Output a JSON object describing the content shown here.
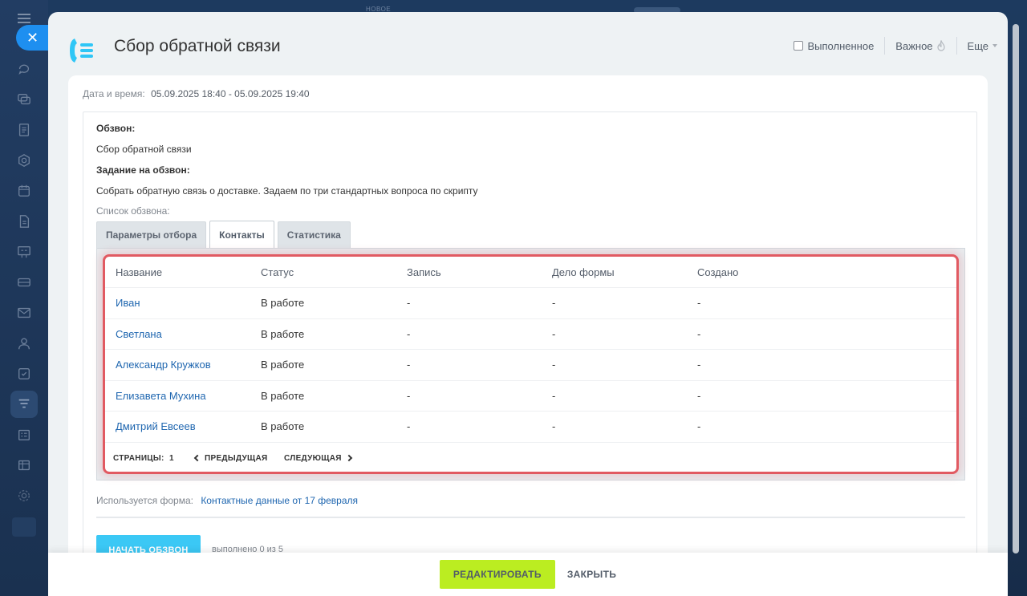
{
  "background": {
    "new_label": "НОВОЕ"
  },
  "sidebar": {
    "icons": [
      "menu-icon",
      "close-icon",
      "chat-icon",
      "messages-icon",
      "feed-icon",
      "hexagon-icon",
      "calendar-icon",
      "document-icon",
      "board-icon",
      "drive-icon",
      "mail-icon",
      "contacts-icon",
      "tasks-icon",
      "filter-icon",
      "planner-icon",
      "grid-icon",
      "settings-icon"
    ]
  },
  "panel": {
    "title": "Сбор обратной связи",
    "completed_label": "Выполненное",
    "important_label": "Важное",
    "more_label": "Еще"
  },
  "details": {
    "datetime_label": "Дата и время:",
    "datetime_value": "05.09.2025 18:40 - 05.09.2025 19:40",
    "call_label": "Обзвон:",
    "call_value": "Сбор обратной связи",
    "task_label": "Задание на обзвон:",
    "task_value": "Собрать обратную связь о доставке. Задаем по три стандартных вопроса по скрипту",
    "list_label": "Список обзвона:"
  },
  "tabs": [
    {
      "label": "Параметры отбора",
      "active": false
    },
    {
      "label": "Контакты",
      "active": true
    },
    {
      "label": "Статистика",
      "active": false
    }
  ],
  "grid": {
    "columns": [
      "Название",
      "Статус",
      "Запись",
      "Дело формы",
      "Создано"
    ],
    "rows": [
      [
        "Иван",
        "В работе",
        "-",
        "-",
        "-"
      ],
      [
        "Светлана",
        "В работе",
        "-",
        "-",
        "-"
      ],
      [
        "Александр Кружков",
        "В работе",
        "-",
        "-",
        "-"
      ],
      [
        "Елизавета Мухина",
        "В работе",
        "-",
        "-",
        "-"
      ],
      [
        "Дмитрий Евсеев",
        "В работе",
        "-",
        "-",
        "-"
      ]
    ],
    "pager": {
      "pages_label": "СТРАНИЦЫ:",
      "current_page": "1",
      "prev_label": "ПРЕДЫДУЩАЯ",
      "next_label": "СЛЕДУЮЩАЯ"
    }
  },
  "form": {
    "used_label": "Используется форма:",
    "form_name": "Контактные данные от 17 февраля"
  },
  "actions": {
    "start_label": "НАЧАТЬ ОБЗВОН",
    "progress_text": "выполнено 0 из 5"
  },
  "footer": {
    "edit_label": "РЕДАКТИРОВАТЬ",
    "close_label": "ЗАКРЫТЬ"
  },
  "colors": {
    "accent_blue": "#3bc8f5",
    "link_blue": "#2067b0",
    "edit_green": "#bbed21",
    "highlight_red": "#e15a62"
  }
}
